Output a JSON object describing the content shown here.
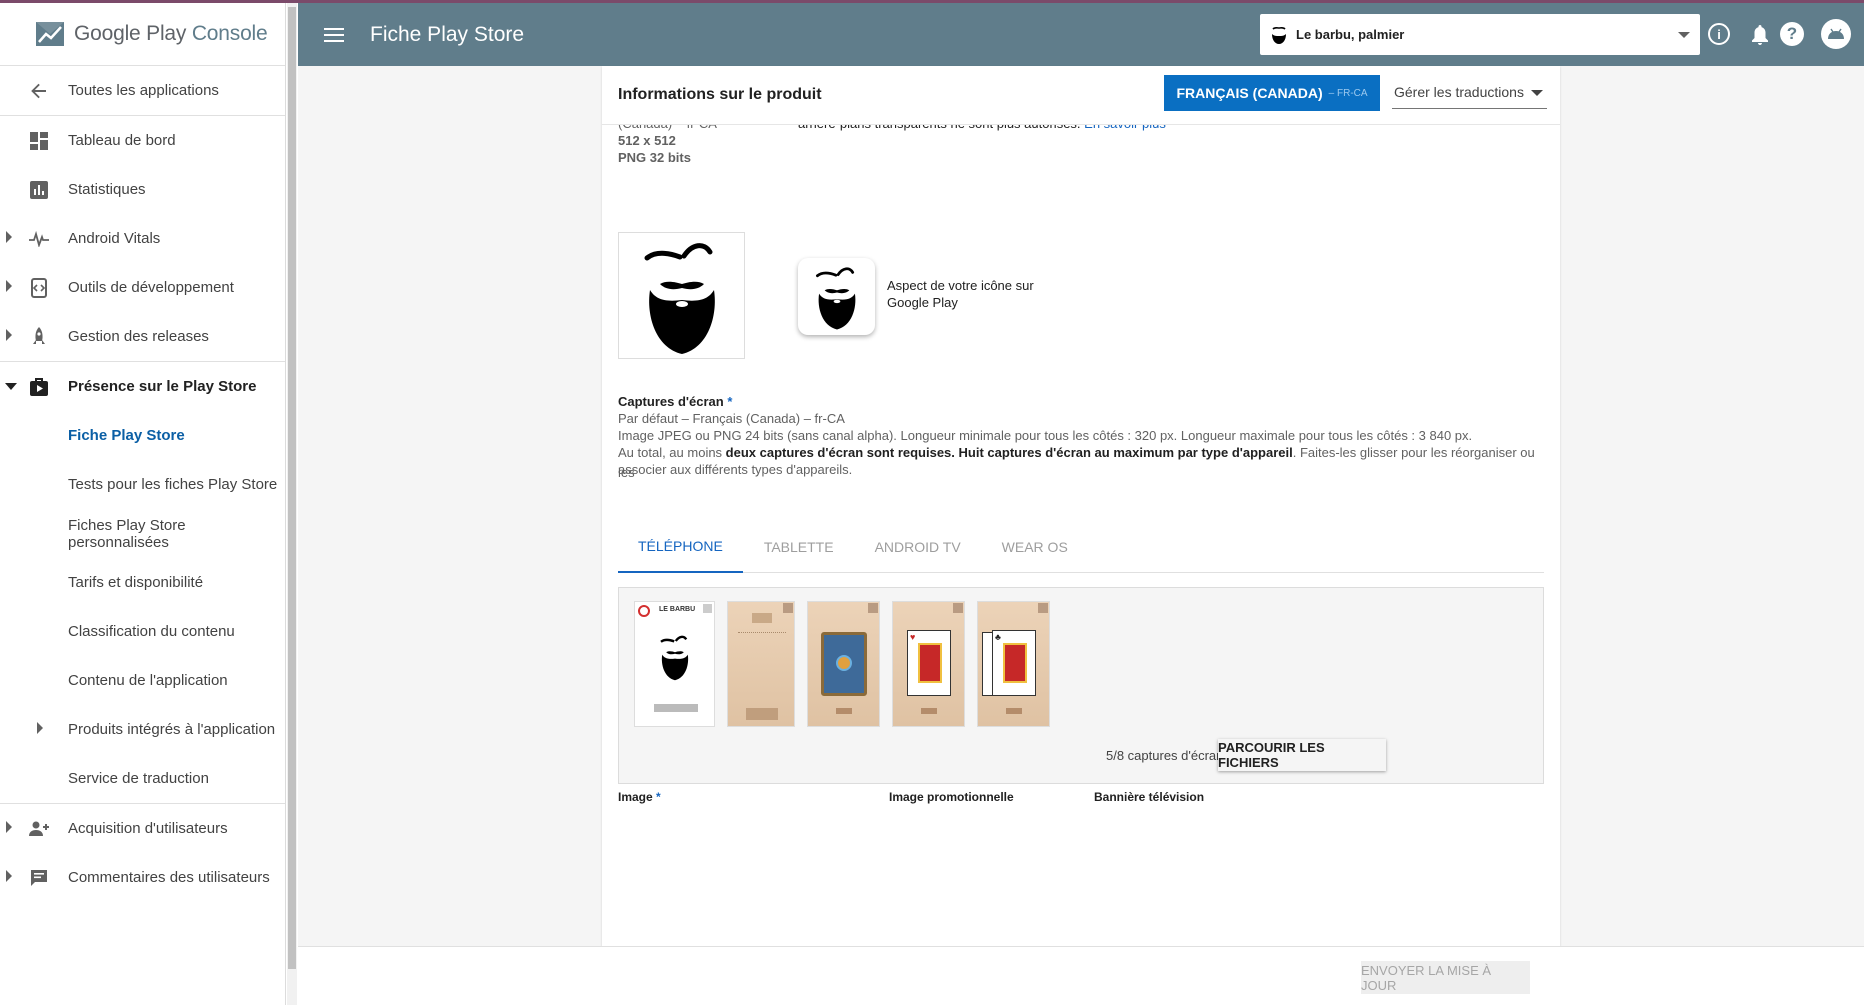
{
  "app": {
    "brand_google_play": "Google Play",
    "brand_console": "Console",
    "page_title": "Fiche Play Store",
    "selected_app": "Le barbu, palmier"
  },
  "sidebar": {
    "back_label": "Toutes les applications",
    "items": [
      {
        "label": "Tableau de bord",
        "icon": "dashboard-icon"
      },
      {
        "label": "Statistiques",
        "icon": "bar-chart-icon"
      },
      {
        "label": "Android Vitals",
        "icon": "pulse-icon"
      },
      {
        "label": "Outils de développement",
        "icon": "dev-tools-icon"
      },
      {
        "label": "Gestion des releases",
        "icon": "rocket-icon"
      },
      {
        "label": "Présence sur le Play Store",
        "icon": "play-store-icon"
      }
    ],
    "store_sub_items": [
      "Fiche Play Store",
      "Tests pour les fiches Play Store",
      "Fiches Play Store personnalisées",
      "Tarifs et disponibilité",
      "Classification du contenu",
      "Contenu de l'application",
      "Produits intégrés à l'application",
      "Service de traduction"
    ],
    "bottom_items": [
      {
        "label": "Acquisition d'utilisateurs",
        "icon": "user-acquisition-icon"
      },
      {
        "label": "Commentaires des utilisateurs",
        "icon": "comments-icon"
      }
    ]
  },
  "product": {
    "title": "Informations sur le produit",
    "lang_button": "FRANÇAIS (CANADA)",
    "lang_code": "– FR-CA",
    "translations_select": "Gérer les traductions",
    "icon_locale": "(Canada) – fr-CA",
    "icon_size": "512 x 512",
    "icon_format": "PNG 32 bits",
    "icon_note": "arrière-plans transparents ne sont plus autorisés.",
    "icon_note_link": "En savoir plus",
    "icon_preview_caption_1": "Aspect de votre icône sur",
    "icon_preview_caption_2": "Google Play"
  },
  "screenshots": {
    "title": "Captures d'écran",
    "required_mark": "*",
    "default_locale": "Par défaut – Français (Canada) – fr-CA",
    "format_rule": "Image JPEG ou PNG 24 bits (sans canal alpha). Longueur minimale pour tous les côtés : 320 px. Longueur maximale pour tous les côtés : 3 840 px.",
    "count_rule_prefix": "Au total, au moins ",
    "count_rule_bold_1": "deux captures d'écran sont requises",
    "count_rule_mid": ". ",
    "count_rule_bold_2": "Huit captures d'écran au maximum par type d'appareil",
    "count_rule_suffix": ". Faites-les glisser pour les réorganiser ou les",
    "count_rule_line2": "associer aux différents types d'appareils.",
    "tabs": [
      "TÉLÉPHONE",
      "TABLETTE",
      "ANDROID TV",
      "WEAR OS"
    ],
    "active_tab": "TÉLÉPHONE",
    "first_shot_title": "LE BARBU",
    "count_label": "5/8 captures d'écran",
    "browse_button": "PARCOURIR LES FICHIERS"
  },
  "below": {
    "image_label": "Image",
    "promo_label": "Image promotionnelle",
    "tv_banner_label": "Bannière télévision"
  },
  "footer": {
    "send_button": "ENVOYER LA MISE À JOUR"
  },
  "colors": {
    "header_bg": "#607d8b",
    "accent": "#0a6fc2",
    "link": "#1565c0",
    "active_nav": "#0b5fa5"
  }
}
